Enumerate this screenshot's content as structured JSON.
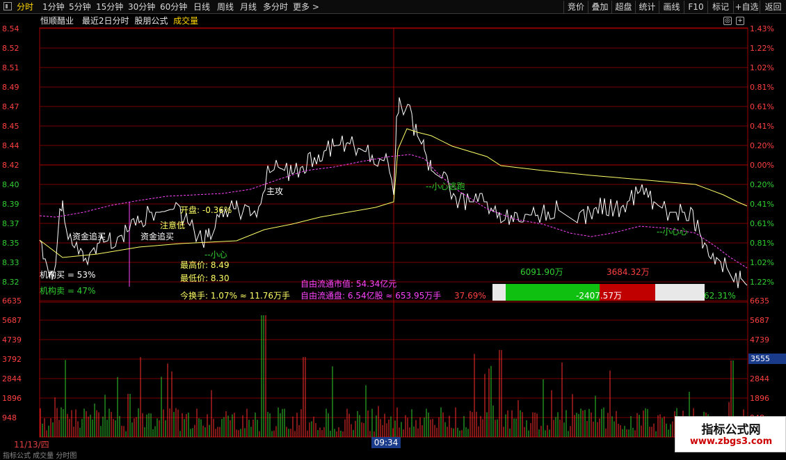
{
  "toolbar": {
    "tabs": [
      "分时",
      "1分钟",
      "5分钟",
      "15分钟",
      "30分钟",
      "60分钟",
      "日线",
      "周线",
      "月线",
      "多分时",
      "更多 >"
    ],
    "active_tab": 0,
    "right_buttons": [
      "竞价",
      "叠加",
      "超盘",
      "统计",
      "画线",
      "F10",
      "标记",
      "+自选",
      "返回"
    ]
  },
  "header": {
    "stock_name": "恒顺醋业",
    "range_label": "最近2日分时",
    "formula_label": "股朋公式",
    "volume_label": "成交量"
  },
  "left_axis": [
    "8.54",
    "8.52",
    "8.51",
    "8.49",
    "8.47",
    "8.45",
    "8.44",
    "8.42",
    "8.40",
    "8.39",
    "8.37",
    "8.35",
    "8.33",
    "8.32"
  ],
  "right_axis": [
    "1.43%",
    "1.22%",
    "1.02%",
    "0.81%",
    "0.61%",
    "0.41%",
    "0.20%",
    "0.00%",
    "0.20%",
    "0.41%",
    "0.61%",
    "0.81%",
    "1.02%",
    "1.22%"
  ],
  "volume_axis": [
    "6635",
    "5687",
    "4739",
    "3792",
    "2844",
    "1896",
    "948"
  ],
  "volume_highlight": "3555",
  "annotations": {
    "zijin_1": "资金追买",
    "zijin_2": "资金追买",
    "zhugong": "主攻",
    "xiaoxin_1": "--小心",
    "xiaoxin_2": "--小心心",
    "xiaoxin_3": "--小心逃跑",
    "zhuli": "注意低",
    "jigou_buy": "机构买 = 53%",
    "jigou_sell": "机构卖 = 47%"
  },
  "stats": {
    "open": "开盘: -0.36%",
    "high": "最高价: 8.49",
    "low": "最低价: 8.30",
    "turnover": "今换手: 1.07% ≈ 11.76万手",
    "float_cap": "自由流通市值: 54.34亿元",
    "float_shares": "自由流通盘: 6.54亿股 ≈ 653.95万手",
    "pct_left": "37.69%",
    "pct_right": "62.31%",
    "buy_amount": "6091.90万",
    "sell_amount": "3684.32万",
    "net_amount": "-2407.57万"
  },
  "footer": {
    "date": "11/13/四",
    "time": "09:34",
    "bottom_text": "指标公式 成交量 分时图"
  },
  "watermark": {
    "line1": "指标公式网",
    "line2": "www.zbgs3.com"
  },
  "colors": {
    "up": "#ff3030",
    "down": "#30d030",
    "price_line": "#ffffff",
    "avg_line": "#ffff66",
    "ma_line": "#ff44ff",
    "grid": "#8b0000"
  }
}
